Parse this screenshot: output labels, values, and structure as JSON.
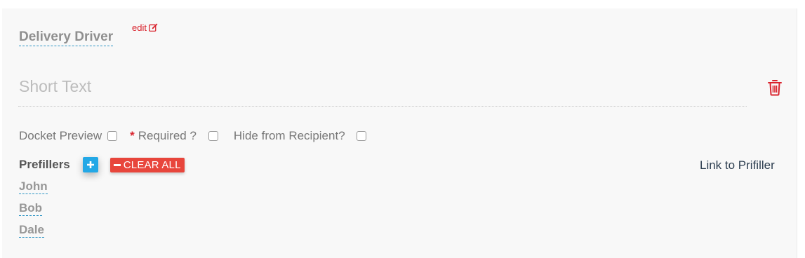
{
  "field": {
    "title": "Delivery Driver",
    "edit_label": "edit",
    "type_placeholder": "Short Text"
  },
  "options": {
    "docket_preview": {
      "label": "Docket Preview",
      "checked": false
    },
    "required": {
      "star": "*",
      "label": "Required ?",
      "checked": false
    },
    "hide_recipient": {
      "label": "Hide from Recipient?",
      "checked": false
    }
  },
  "prefillers": {
    "label": "Prefillers",
    "clear_all_label": "CLEAR ALL",
    "link_label": "Link to Prifiller",
    "items": [
      "John",
      "Bob",
      "Dale"
    ]
  },
  "icons": {
    "edit": "edit-pencil-square-icon",
    "trash": "trash-icon",
    "add": "plus-icon",
    "clear": "minus-icon"
  },
  "colors": {
    "accent_red": "#d9232d",
    "add_blue": "#23a8e6",
    "clear_red": "#e8463c",
    "dashed_underline": "#2a93c4"
  }
}
